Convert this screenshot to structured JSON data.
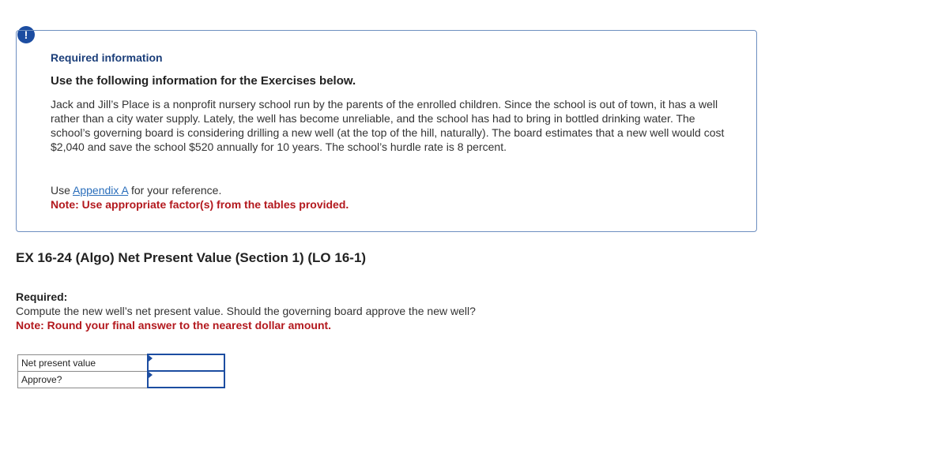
{
  "alert": {
    "icon_glyph": "!",
    "icon_name": "exclamation-icon",
    "color": "#1c4da1"
  },
  "info": {
    "title": "Required information",
    "subtitle": "Use the following information for the Exercises below.",
    "body": "Jack and Jill’s Place is a nonprofit nursery school run by the parents of the enrolled children. Since the school is out of town, it has a well rather than a city water supply. Lately, the well has become unreliable, and the school has had to bring in bottled drinking water. The school’s governing board is considering drilling a new well (at the top of the hill, naturally). The board estimates that a new well would cost $2,040 and save the school $520 annually for 10 years. The school’s hurdle rate is 8 percent.",
    "ref_prefix": "Use ",
    "ref_link": "Appendix A",
    "ref_suffix": " for your reference.",
    "note": "Note: Use appropriate factor(s) from the tables provided."
  },
  "exercise": {
    "title": "EX 16-24 (Algo) Net Present Value (Section 1) (LO 16-1)",
    "required_label": "Required:",
    "required_text": "Compute the new well’s net present value. Should the governing board approve the new well?",
    "note": "Note: Round your final answer to the nearest dollar amount."
  },
  "answer_table": {
    "rows": [
      {
        "label": "Net present value",
        "value": ""
      },
      {
        "label": "Approve?",
        "value": ""
      }
    ]
  },
  "colors": {
    "accent": "#1c4da1",
    "note_red": "#b3191e",
    "link": "#2a6ebb"
  }
}
